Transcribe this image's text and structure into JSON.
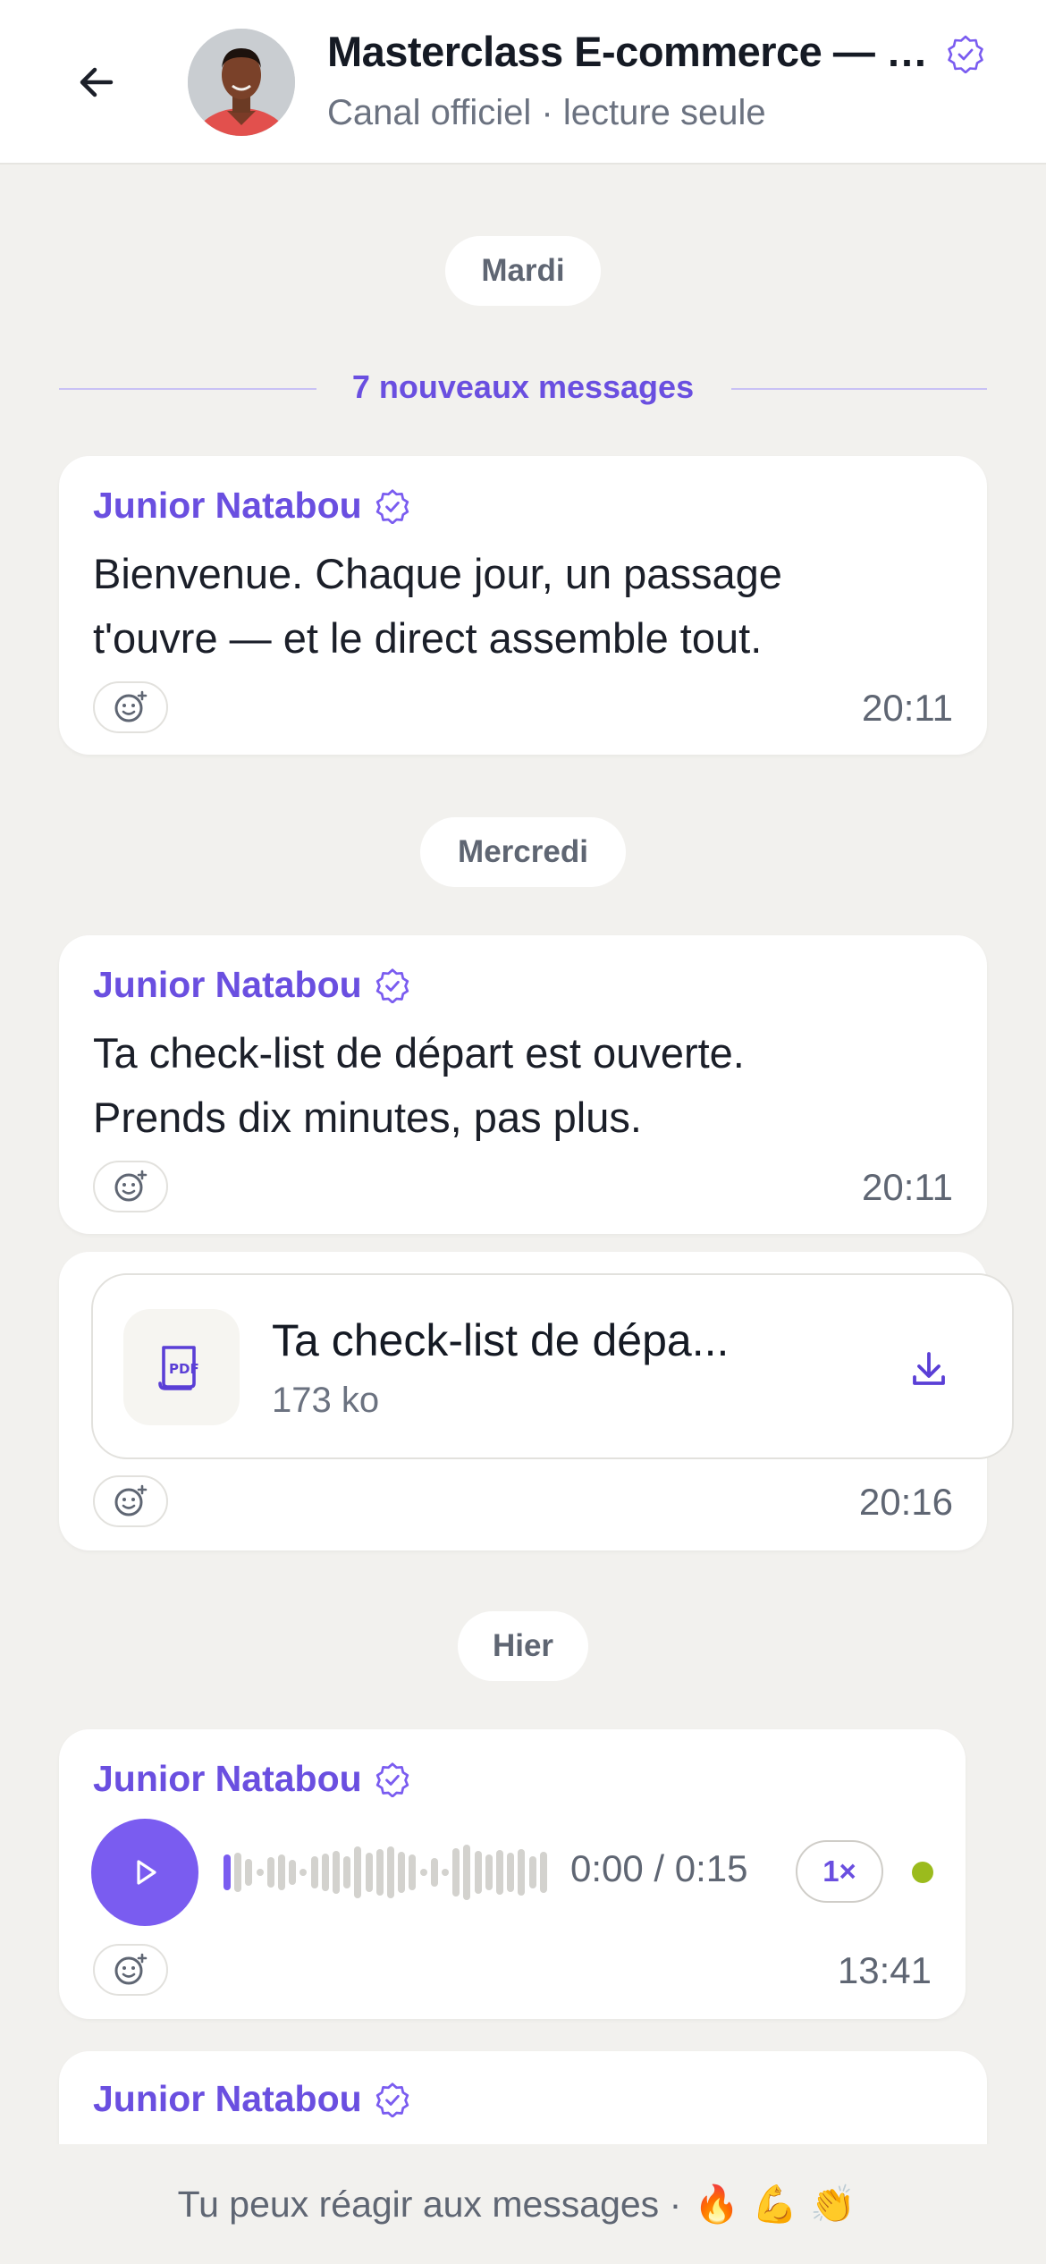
{
  "header": {
    "title": "Masterclass E-commerce — …",
    "subtitle": "Canal officiel · lecture seule",
    "back_icon": "arrow-left-icon",
    "verified_icon": "verified-badge-icon"
  },
  "days": {
    "tuesday": "Mardi",
    "wednesday": "Mercredi",
    "yesterday": "Hier"
  },
  "new_messages_label": "7 nouveaux messages",
  "messages": [
    {
      "author": "Junior Natabou",
      "text_line1": "Bienvenue. Chaque jour, un passage",
      "text_line2": "t'ouvre — et le direct assemble tout.",
      "time": "20:11"
    },
    {
      "author": "Junior Natabou",
      "text_line1": "Ta check-list de départ est ouverte.",
      "text_line2": "Prends dix minutes, pas plus.",
      "time": "20:11"
    },
    {
      "file_name": "Ta check-list de dépa...",
      "file_size": "173 ko",
      "file_icon": "pdf-file-icon",
      "time": "20:16"
    },
    {
      "author": "Junior Natabou",
      "voice_duration": "0:00 / 0:15",
      "voice_progress": 0.0,
      "speed": "1×",
      "time": "13:41"
    },
    {
      "author": "Junior Natabou"
    }
  ],
  "footer": {
    "text": "Tu peux réagir aux messages ·",
    "emojis": "🔥💪👏"
  },
  "colors": {
    "accent": "#6a4fe0",
    "background": "#f2f1ee",
    "online_dot": "#9bbb1d"
  }
}
